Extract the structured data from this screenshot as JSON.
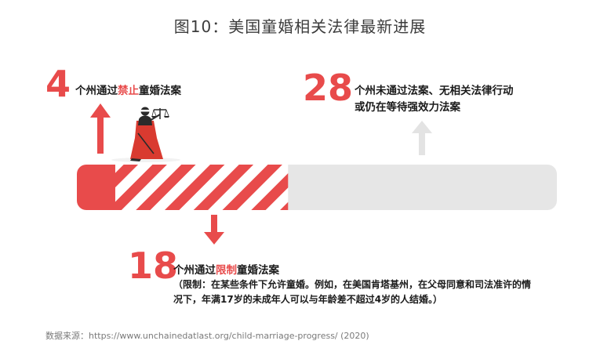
{
  "title": "图10：美国童婚相关法律最新进展",
  "colors": {
    "accent": "#e84b4b",
    "grey": "#e6e6e6",
    "arrow_grey": "#e3e3e3",
    "text": "#1a1a1a"
  },
  "chart_data": {
    "type": "bar",
    "total": 50,
    "series": [
      {
        "value": 4,
        "label_pre": "个州通过",
        "label_hl": "禁止",
        "label_post": "童婚法案",
        "style": "solid"
      },
      {
        "value": 18,
        "label_pre": "个州通过",
        "label_hl": "限制",
        "label_post": "童婚法案",
        "style": "striped"
      },
      {
        "value": 28,
        "label_line1": "个州未通过法案、无相关法律行动",
        "label_line2": "或仍在等待强效力法案",
        "style": "grey"
      }
    ],
    "note_line1": "（限制：在某些条件下允许童婚。例如，在美国肯塔基州，在父母同意和司法准许的情",
    "note_line2": "况下，年满17岁的未成年人可以与年龄差不超过4岁的人结婚。）"
  },
  "source": "数据来源：https://www.unchainedatlast.org/child-marriage-progress/ (2020)",
  "icons": {
    "figure": "lady-justice-icon"
  }
}
